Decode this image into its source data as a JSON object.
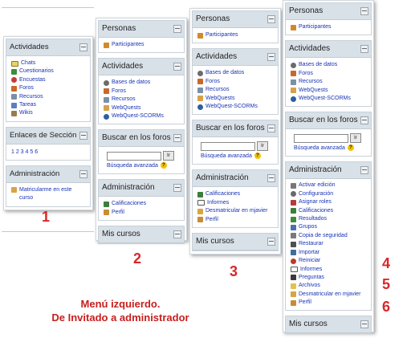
{
  "col1": {
    "actividades": {
      "title": "Actividades",
      "items": [
        "Chats",
        "Cuestionarios",
        "Encuestas",
        "Foros",
        "Recursos",
        "Tareas",
        "Wikis"
      ]
    },
    "enlaces": {
      "title": "Enlaces de Sección",
      "links": "1 2 3 4 5 6"
    },
    "admin": {
      "title": "Administración",
      "items": [
        "Matricularme en este curso"
      ]
    }
  },
  "col2": {
    "personas": {
      "title": "Personas",
      "items": [
        "Participantes"
      ]
    },
    "actividades": {
      "title": "Actividades",
      "items": [
        "Bases de datos",
        "Foros",
        "Recursos",
        "WebQuests",
        "WebQuest-SCORMs"
      ]
    },
    "buscar": {
      "title": "Buscar en los foros",
      "button": "Ir",
      "advanced": "Búsqueda avanzada"
    },
    "admin": {
      "title": "Administración",
      "items": [
        "Calificaciones",
        "Perfil"
      ]
    },
    "cursos": {
      "title": "Mis cursos"
    }
  },
  "col3": {
    "personas": {
      "title": "Personas",
      "items": [
        "Participantes"
      ]
    },
    "actividades": {
      "title": "Actividades",
      "items": [
        "Bases de datos",
        "Foros",
        "Recursos",
        "WebQuests",
        "WebQuest-SCORMs"
      ]
    },
    "buscar": {
      "title": "Buscar en los foros",
      "button": "Ir",
      "advanced": "Búsqueda avanzada"
    },
    "admin": {
      "title": "Administración",
      "items": [
        "Calificaciones",
        "Informes",
        "Desmatricular en mjavier",
        "Perfil"
      ]
    },
    "cursos": {
      "title": "Mis cursos"
    }
  },
  "col4": {
    "personas": {
      "title": "Personas",
      "items": [
        "Participantes"
      ]
    },
    "actividades": {
      "title": "Actividades",
      "items": [
        "Bases de datos",
        "Foros",
        "Recursos",
        "WebQuests",
        "WebQuest-SCORMs"
      ]
    },
    "buscar": {
      "title": "Buscar en los foros",
      "button": "Ir",
      "advanced": "Búsqueda avanzada"
    },
    "admin": {
      "title": "Administración",
      "items": [
        "Activar edición",
        "Configuración",
        "Asignar roles",
        "Calificaciones",
        "Resultados",
        "Grupos",
        "Copia de seguridad",
        "Restaurar",
        "Importar",
        "Reiniciar",
        "Informes",
        "Preguntas",
        "Archivos",
        "Desmatricular en mjavier",
        "Perfil"
      ]
    },
    "cursos": {
      "title": "Mis cursos"
    }
  },
  "numbers": [
    "1",
    "2",
    "3",
    "4",
    "5",
    "6"
  ],
  "caption": {
    "line1": "Menú izquierdo.",
    "line2": "De Invitado a administrador"
  },
  "colors": {
    "header_bg": "#d9e1e8",
    "link": "#1733b5",
    "accent_red": "#d9262a"
  }
}
